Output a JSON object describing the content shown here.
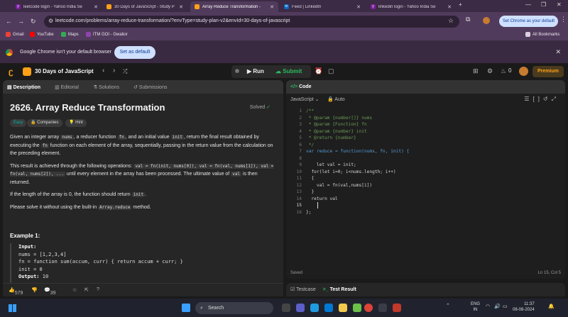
{
  "browser": {
    "tabs": [
      {
        "title": "leetcode login - Yahoo India Se",
        "icon": "yahoo-icon",
        "color": "#7b1fa2"
      },
      {
        "title": "30 Days of JavaScript - Study P",
        "icon": "leetcode-icon",
        "color": "#ffa116"
      },
      {
        "title": "Array Reduce Transformation -",
        "icon": "leetcode-icon",
        "color": "#ffa116"
      },
      {
        "title": "Feed | LinkedIn",
        "icon": "linkedin-icon",
        "color": "#0a66c2"
      },
      {
        "title": "linkedin login - Yahoo India Se",
        "icon": "yahoo-icon",
        "color": "#7b1fa2"
      }
    ],
    "new_tab": "+",
    "url": "leetcode.com/problems/array-reduce-transformation/?envType=study-plan-v2&envId=30-days-of-javascript",
    "set_default_label": "Set Chrome as your default",
    "bookmarks": [
      {
        "label": "Gmail",
        "color": "#ea4335"
      },
      {
        "label": "YouTube",
        "color": "#ff0000"
      },
      {
        "label": "Maps",
        "color": "#34a853"
      },
      {
        "label": "ITM GOI - Gwalior",
        "color": "#8e44ad"
      }
    ],
    "all_bookmarks": "All Bookmarks",
    "infobar": {
      "message": "Google Chrome isn't your default browser",
      "button": "Set as default"
    }
  },
  "leetcode": {
    "plan_title": "30 Days of JavaScript",
    "run_label": "Run",
    "submit_label": "Submit",
    "streak": "0",
    "premium_label": "Premium",
    "tabs": [
      "Description",
      "Editorial",
      "Solutions",
      "Submissions"
    ],
    "question": {
      "title": "2626. Array Reduce Transformation",
      "status": "Solved",
      "difficulty": "Easy",
      "companies": "Companies",
      "hint": "Hint",
      "p1a": "Given an integer array ",
      "p1c1": "nums",
      "p1b": ", a reducer function ",
      "p1c2": "fn",
      "p1c": ", and an initial value ",
      "p1c3": "init",
      "p1d": ", return the final result obtained by executing the ",
      "p1c4": "fn",
      "p1e": " function on each element of the array, sequentially, passing in the return value from the calculation on the preceding element.",
      "p2a": "This result is achieved through the following operations: ",
      "p2c1": "val = fn(init, nums[0]), val = fn(val, nums[1]), val = fn(val, nums[2]), ...",
      "p2b": " until every element in the array has been processed. The ultimate value of ",
      "p2c2": "val",
      "p2c": " is then returned.",
      "p3a": "If the length of the array is 0, the function should return ",
      "p3c": "init",
      "p3b": ".",
      "p4a": "Please solve it without using the built-in ",
      "p4c": "Array.reduce",
      "p4b": " method.",
      "example_title": "Example 1:",
      "example_input_label": "Input:",
      "example_lines": [
        "nums = [1,2,3,4]",
        "fn = function sum(accum, curr) { return accum + curr; }",
        "init = 0"
      ],
      "example_output_label": "Output:",
      "example_output": "10"
    },
    "footer": {
      "likes": "579",
      "comments": "39"
    },
    "code_header": "Code",
    "language": "JavaScript",
    "auto": "Auto",
    "code_lines": [
      "/**",
      " * @param {number[]} nums",
      " * @param {Function} fn",
      " * @param {number} init",
      " * @return {number}",
      " */",
      "var reduce = function(nums, fn, init) {",
      "",
      "    let val = init;",
      "  for(let i=0; i<nums.length; i++)",
      "  {",
      "    val = fn(val,nums[i])",
      "  }",
      "  return val",
      "",
      "};"
    ],
    "saved": "Saved",
    "cursor": "Ln 15, Col 5",
    "testcase": "Testcase",
    "test_result": "Test Result"
  },
  "taskbar": {
    "search": "Search",
    "lang": "ENG",
    "region": "IN",
    "time": "11:37",
    "date": "08-08-2024"
  }
}
